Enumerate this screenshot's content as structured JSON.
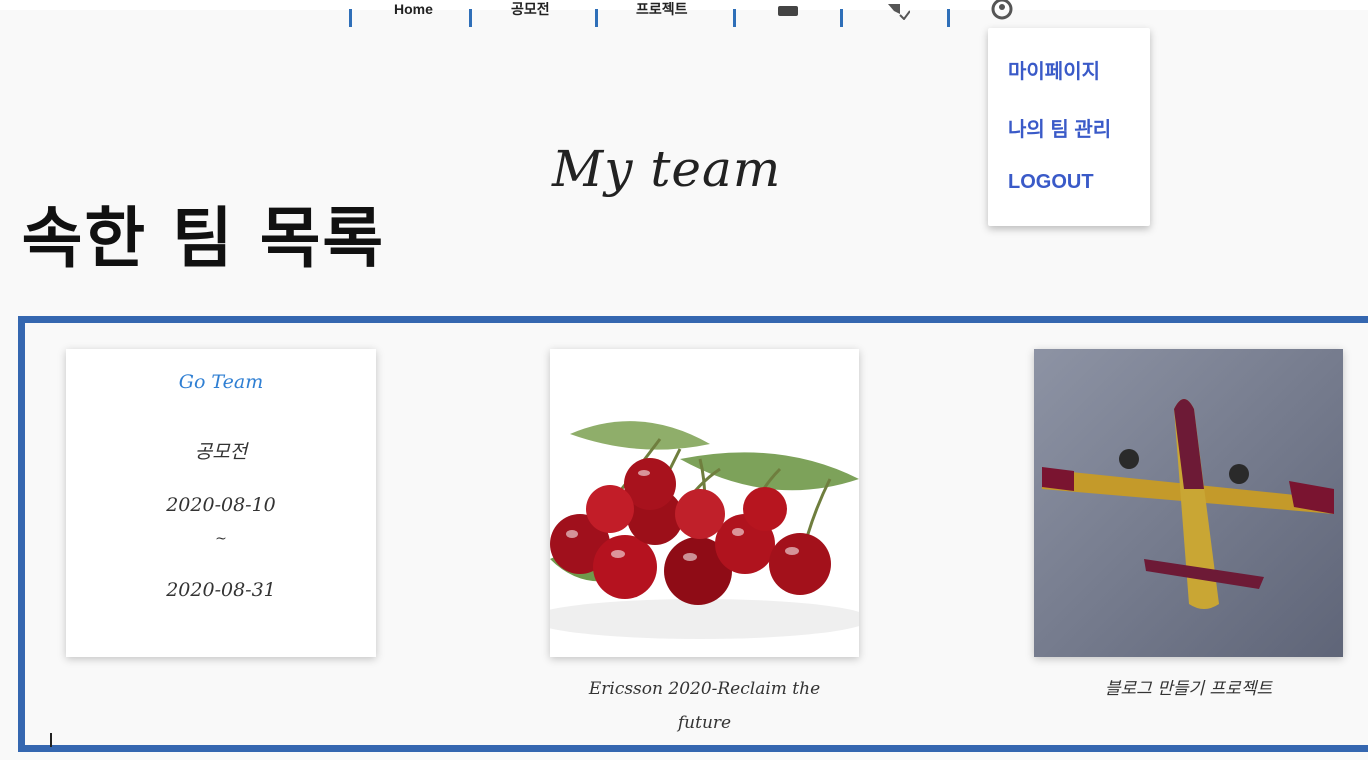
{
  "nav": {
    "items": [
      "Home",
      "공모전",
      "프로젝트"
    ],
    "icons": [
      "chat-icon",
      "notification-icon",
      "user-icon"
    ]
  },
  "dropdown": {
    "items": [
      "마이페이지",
      "나의 팀 관리",
      "LOGOUT"
    ]
  },
  "page": {
    "title": "My team",
    "heading": "속한 팀 목록"
  },
  "teams": [
    {
      "name": "Go Team",
      "category": "공모전",
      "start": "2020-08-10",
      "separator": "~",
      "end": "2020-08-31"
    },
    {
      "image": "cherries",
      "caption_line1": "Ericsson 2020-Reclaim the",
      "caption_line2": "future"
    },
    {
      "image": "airplane",
      "caption": "블로그 만들기 프로젝트"
    }
  ],
  "colors": {
    "accent": "#3567b0",
    "link": "#3a5ac8",
    "team_name": "#2f7fd3"
  }
}
